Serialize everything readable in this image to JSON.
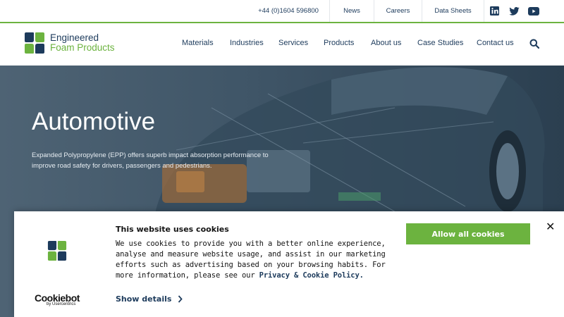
{
  "topbar": {
    "phone": "+44 (0)1604 596800",
    "links": [
      "News",
      "Careers",
      "Data Sheets"
    ],
    "social": [
      "linkedin-icon",
      "twitter-icon",
      "youtube-icon"
    ]
  },
  "brand": {
    "line1": "Engineered",
    "line2": "Foam Products",
    "colors": {
      "navy": "#1d3b5c",
      "green": "#6cb33f"
    }
  },
  "nav": {
    "items": [
      "Materials",
      "Industries",
      "Services",
      "Products",
      "About us",
      "Case Studies",
      "Contact us"
    ]
  },
  "hero": {
    "title": "Automotive",
    "text": "Expanded Polypropylene (EPP) offers superb impact absorption performance to improve road safety for drivers, passengers and pedestrians."
  },
  "cookie": {
    "title": "This website uses cookies",
    "body": "We use cookies to provide you with a better online experience, analyse and measure website usage, and assist in our marketing efforts such as advertising based on your browsing habits. For more information, please see our",
    "link": "Privacy & Cookie Policy.",
    "show_details": "Show details",
    "allow_all": "Allow all cookies",
    "close": "✕",
    "provider": "Cookiebot",
    "provider_sub": "by Usercentrics"
  }
}
